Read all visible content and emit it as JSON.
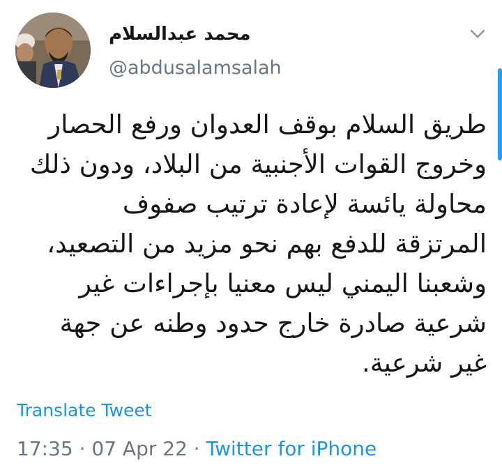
{
  "author": {
    "display_name": "محمد عبدالسلام",
    "handle": "@abdusalamsalah",
    "avatar_icon": "profile-photo"
  },
  "menu_icon": "chevron-down-icon",
  "tweet": {
    "text": "طريق السلام بوقف العدوان ورفع الحصار وخروج القوات الأجنبية من البلاد، ودون ذلك محاولة يائسة لإعادة ترتيب صفوف المرتزقة للدفع بهم نحو مزيد من التصعيد، وشعبنا اليمني ليس معنيا بإجراءات غير شرعية صادرة خارج حدود وطنه عن جهة غير شرعية.",
    "translate_label": "Translate Tweet"
  },
  "meta": {
    "time": "17:35",
    "separator1": " · ",
    "date": "07 Apr 22",
    "separator2": " · ",
    "source": "Twitter for iPhone"
  },
  "colors": {
    "link": "#1b95e0",
    "secondary_text": "#657786",
    "primary_text": "#14171a",
    "scrollbar": "#1da1f2"
  }
}
